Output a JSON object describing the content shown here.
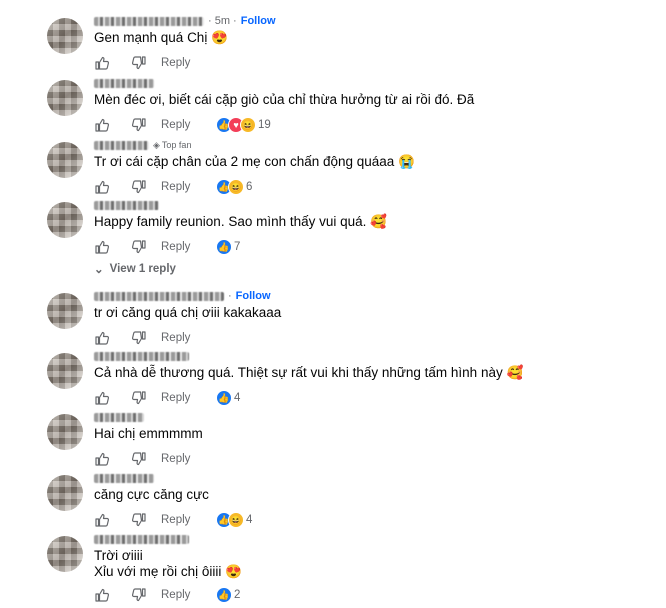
{
  "comments": [
    {
      "name_width": 110,
      "time": "· 5m ·",
      "follow": "Follow",
      "text": "Gen mạnh quá Chị 😍",
      "reply": "Reply",
      "reactions": [],
      "count": ""
    },
    {
      "name_width": 60,
      "time": "",
      "follow": "",
      "text": "Mèn đéc ơi, biết cái cặp giò của chỉ thừa hưởng từ ai rồi đó. Đã",
      "reply": "Reply",
      "reactions": [
        "like",
        "love",
        "haha"
      ],
      "count": "19"
    },
    {
      "name_width": 55,
      "time": "",
      "follow": "",
      "topfan": "Top fan",
      "text": "Tr ơi cái cặp chân của 2 mẹ con chấn động quáaa 😭",
      "reply": "Reply",
      "reactions": [
        "like",
        "haha"
      ],
      "count": "6"
    },
    {
      "name_width": 65,
      "time": "",
      "follow": "",
      "text": "Happy family reunion. Sao mình thấy vui quá. 🥰",
      "reply": "Reply",
      "reactions": [
        "like"
      ],
      "count": "7",
      "view_replies": "View 1 reply"
    },
    {
      "name_width": 130,
      "time": "",
      "follow": "Follow",
      "text": "tr ơi căng quá chị ơiii kakakaaa",
      "reply": "Reply",
      "reactions": [],
      "count": ""
    },
    {
      "name_width": 95,
      "time": "",
      "follow": "",
      "text": "Cả nhà dễ thương quá. Thiệt sự rất vui khi thấy những tấm hình này 🥰",
      "reply": "Reply",
      "reactions": [
        "like"
      ],
      "count": "4"
    },
    {
      "name_width": 50,
      "time": "",
      "follow": "",
      "text": "Hai chị emmmmm",
      "reply": "Reply",
      "reactions": [],
      "count": ""
    },
    {
      "name_width": 60,
      "time": "",
      "follow": "",
      "text": "căng cực căng cực",
      "reply": "Reply",
      "reactions": [
        "like",
        "haha"
      ],
      "count": "4"
    },
    {
      "name_width": 95,
      "time": "",
      "follow": "",
      "text": "Trời ơiiii",
      "text2": "Xỉu với mẹ rồi chị ôiiii 😍",
      "reply": "Reply",
      "reactions": [
        "like"
      ],
      "count": "2"
    }
  ]
}
